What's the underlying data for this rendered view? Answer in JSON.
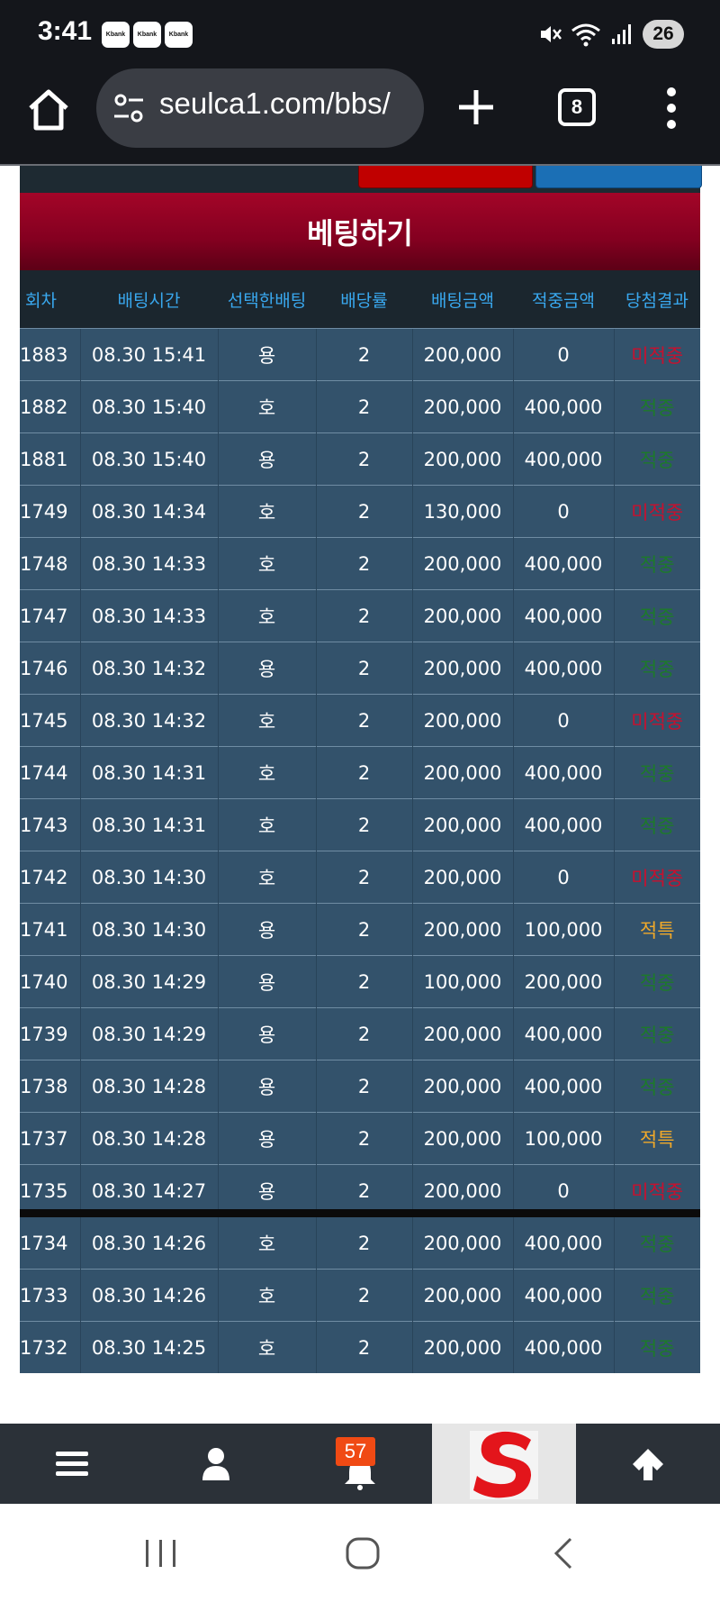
{
  "status_bar": {
    "time": "3:41",
    "app_badges": [
      "Kbank",
      "Kbank",
      "Kbank"
    ],
    "battery": "26"
  },
  "browser": {
    "url": "seulca1.com/bbs/",
    "tab_count": "8"
  },
  "page": {
    "section_title": "베팅하기",
    "table": {
      "headers": [
        "회차",
        "배팅시간",
        "선택한배팅",
        "배당률",
        "배팅금액",
        "적중금액",
        "당첨결과"
      ],
      "rows": [
        [
          "1883",
          "08.30 15:41",
          "용",
          "2",
          "200,000",
          "0",
          "미적중"
        ],
        [
          "1882",
          "08.30 15:40",
          "호",
          "2",
          "200,000",
          "400,000",
          "적중"
        ],
        [
          "1881",
          "08.30 15:40",
          "용",
          "2",
          "200,000",
          "400,000",
          "적중"
        ],
        [
          "1749",
          "08.30 14:34",
          "호",
          "2",
          "130,000",
          "0",
          "미적중"
        ],
        [
          "1748",
          "08.30 14:33",
          "호",
          "2",
          "200,000",
          "400,000",
          "적중"
        ],
        [
          "1747",
          "08.30 14:33",
          "호",
          "2",
          "200,000",
          "400,000",
          "적중"
        ],
        [
          "1746",
          "08.30 14:32",
          "용",
          "2",
          "200,000",
          "400,000",
          "적중"
        ],
        [
          "1745",
          "08.30 14:32",
          "호",
          "2",
          "200,000",
          "0",
          "미적중"
        ],
        [
          "1744",
          "08.30 14:31",
          "호",
          "2",
          "200,000",
          "400,000",
          "적중"
        ],
        [
          "1743",
          "08.30 14:31",
          "호",
          "2",
          "200,000",
          "400,000",
          "적중"
        ],
        [
          "1742",
          "08.30 14:30",
          "호",
          "2",
          "200,000",
          "0",
          "미적중"
        ],
        [
          "1741",
          "08.30 14:30",
          "용",
          "2",
          "200,000",
          "100,000",
          "적특"
        ],
        [
          "1740",
          "08.30 14:29",
          "용",
          "2",
          "100,000",
          "200,000",
          "적중"
        ],
        [
          "1739",
          "08.30 14:29",
          "용",
          "2",
          "200,000",
          "400,000",
          "적중"
        ],
        [
          "1738",
          "08.30 14:28",
          "용",
          "2",
          "200,000",
          "400,000",
          "적중"
        ],
        [
          "1737",
          "08.30 14:28",
          "용",
          "2",
          "200,000",
          "100,000",
          "적특"
        ],
        [
          "1735",
          "08.30 14:27",
          "용",
          "2",
          "200,000",
          "0",
          "미적중"
        ],
        [
          "1734",
          "08.30 14:26",
          "호",
          "2",
          "200,000",
          "400,000",
          "적중"
        ],
        [
          "1733",
          "08.30 14:26",
          "호",
          "2",
          "200,000",
          "400,000",
          "적중"
        ],
        [
          "1732",
          "08.30 14:25",
          "호",
          "2",
          "200,000",
          "400,000",
          "적중"
        ]
      ]
    },
    "result_colors": {
      "미적중": "#c8102e",
      "적중": "#1d7a2a",
      "적특": "#f0a92a"
    }
  },
  "bottom_nav": {
    "items": [
      "menu-icon",
      "user-icon",
      "bell-icon",
      "site-logo",
      "arrow-up-icon"
    ],
    "notification_count": "57"
  },
  "system_nav": {
    "buttons": [
      "recents",
      "home",
      "back"
    ]
  },
  "colors": {
    "header_red": "#a30528",
    "table_row": "#33526b",
    "table_header_text": "#39a8ef",
    "browser_bar": "#14161b"
  }
}
